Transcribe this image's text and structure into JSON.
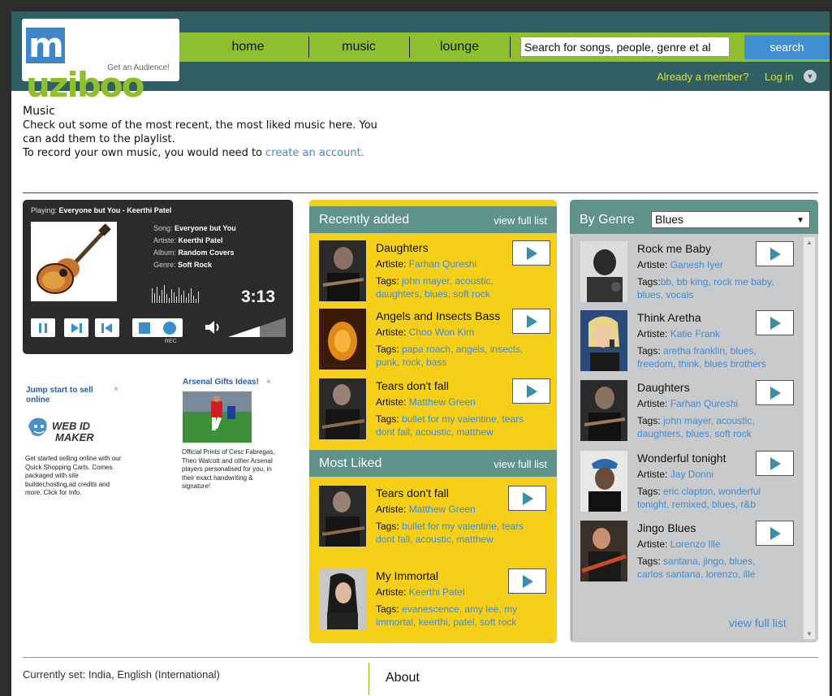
{
  "header": {
    "logo_text": "muziboo",
    "tagline": "Get an Audience!",
    "nav": [
      "home",
      "music",
      "lounge"
    ],
    "search_placeholder": "Search for songs, people, genre et al",
    "search_button": "search",
    "member_prompt": "Already a member?",
    "login": "Log in"
  },
  "intro": {
    "title": "Music",
    "line1": "Check out some of the most recent, the most liked music here. You",
    "line2": "can add them to the playlist.",
    "line3_prefix": "To record your own music, you would need to ",
    "line3_link": "create an account."
  },
  "player": {
    "playing_label": "Playing:",
    "playing_title": "Everyone but You - Keerthi Patel",
    "song_label": "Song:",
    "song": "Everyone but You",
    "artiste_label": "Artiste:",
    "artiste": "Keerthi Patel",
    "album_label": "Album:",
    "album": "Random Covers",
    "genre_label": "Genre:",
    "genre": "Soft Rock",
    "time": "3:13",
    "rec_label": "REC",
    "volume_level": 0.55
  },
  "ads": {
    "ad1_title": "Jump start to sell online",
    "ad1_logo": "WEB ID MAKER",
    "ad1_text": "Get started selling online with our Quick Shopping Carts. Comes packaged with site builder,hosting,ad credits and more. Click for Info.",
    "ad2_title": "Arsenal Gifts Ideas!",
    "ad2_text": "Official Prints of Cesc Fabregas, Theo Walcott and other Arsenal players personalised for you, in their exact handwriting & signature!",
    "close": "×"
  },
  "recent": {
    "title": "Recently added",
    "view_full": "view full list",
    "tracks": [
      {
        "name": "Daughters",
        "artist": "Farhan Qureshi",
        "tags1": "john mayer, acoustic,",
        "tags2": "daughters, blues, soft rock"
      },
      {
        "name": "Angels and Insects Bass",
        "artist": "Choo Won Kim",
        "tags1": "papa roach, angels, insects,",
        "tags2": "punk, rock, bass"
      },
      {
        "name": "Tears don't fall",
        "artist": "Matthew Green",
        "tags1": "bullet for my valentine, tears",
        "tags2": "dont fall, acoustic, matthew"
      }
    ]
  },
  "liked": {
    "title": "Most Liked",
    "view_full": "view full list",
    "tracks": [
      {
        "name": "Tears don't fall",
        "artist": "Matthew Green",
        "tags1": "bullet for my valentine, tears",
        "tags2": "dont fall, acoustic, matthew"
      },
      {
        "name": "My Immortal",
        "artist": "Keerthi Patel",
        "tags1": "evanescence, amy lee, my",
        "tags2": "immortal, keerthi, patel, soft rock"
      }
    ]
  },
  "genre": {
    "title": "By Genre",
    "selected": "Blues",
    "view_full": "view full list",
    "tracks": [
      {
        "name": "Rock me Baby",
        "artist": "Ganesh Iyer",
        "tags1": "bb, bb king, rock me baby,",
        "tags2": "blues, vocals"
      },
      {
        "name": "Think Aretha",
        "artist": "Katie Frank",
        "tags1": "aretha franklin, blues,",
        "tags2": "freedom, think, blues brothers"
      },
      {
        "name": "Daughters",
        "artist": "Farhan Qureshi",
        "tags1": "john mayer, acoustic,",
        "tags2": "daughters, blues, soft rock"
      },
      {
        "name": "Wonderful tonight",
        "artist": "Jay Donni",
        "tags1": "eric clapton, wonderful",
        "tags2": "tonight, remixed, blues, r&b"
      },
      {
        "name": "Jingo Blues",
        "artist": "Lorenzo Ille",
        "tags1": "santana, jingo, blues,",
        "tags2": "carlos santana, lorenzo, ille"
      }
    ]
  },
  "labels": {
    "artiste": "Artiste: ",
    "tags": "Tags: ",
    "tags_tight": "Tags:"
  },
  "footer": {
    "currently": "Currently set: India, English (International)",
    "about": "About"
  },
  "colors": {
    "header_bg": "#2f5f63",
    "nav_green": "#8fbf2e",
    "search_blue": "#3f8fd2",
    "panel_yellow": "#f6cf19",
    "panel_head_teal": "#5f928b",
    "genre_gray": "#c9cacb",
    "link_blue": "#3c8cd6"
  }
}
